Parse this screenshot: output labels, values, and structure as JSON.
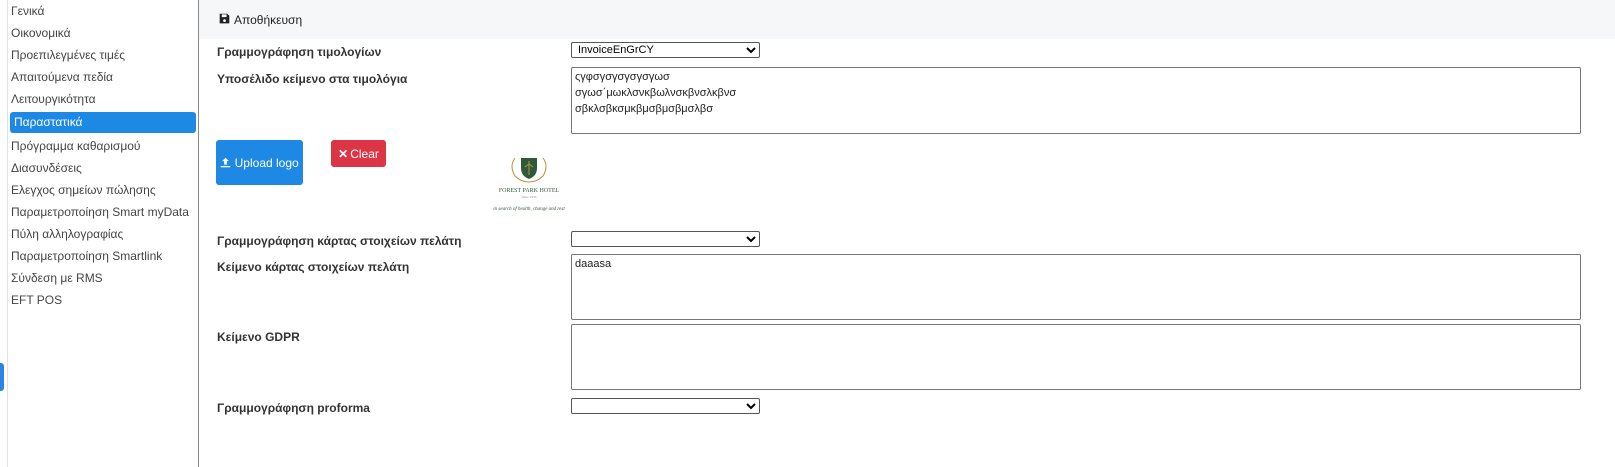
{
  "sidebar": {
    "items": [
      {
        "label": "Γενικά"
      },
      {
        "label": "Οικονομικά"
      },
      {
        "label": "Προεπιλεγμένες τιμές"
      },
      {
        "label": "Απαιτούμενα πεδία"
      },
      {
        "label": "Λειτουργικότητα"
      },
      {
        "label": "Παραστατικά",
        "active": true
      },
      {
        "label": "Πρόγραμμα καθαρισμού"
      },
      {
        "label": "Διασυνδέσεις"
      },
      {
        "label": "Ελεγχος σημείων πώλησης"
      },
      {
        "label": "Παραμετροποίηση Smart myData"
      },
      {
        "label": "Πύλη αλληλογραφίας"
      },
      {
        "label": "Παραμετροποίηση Smartlink"
      },
      {
        "label": "Σύνδεση με RMS"
      },
      {
        "label": "EFT POS"
      }
    ]
  },
  "toolbar": {
    "save_label": "Αποθήκευση",
    "save_icon": "floppy-disk-icon"
  },
  "form": {
    "invoice_layout_label": "Γραμμογράφηση τιμολογίων",
    "invoice_layout_value": "InvoiceEnGrCY",
    "invoice_footer_label": "Υποσέλιδο κείμενο στα τιμολόγια",
    "invoice_footer_value": "ςγφσγσγσγσγσγωσ\nσγωσ΄μωκλσνκβωλνσκβνσλκβνσ\nσβκλσβκσμκβμσβμσβμσλβσ",
    "upload_logo_label": "Upload logo",
    "upload_icon": "upload-icon",
    "clear_label": "Clear",
    "clear_icon": "x-icon",
    "logo": {
      "name": "FOREST PARK HOTEL",
      "since": "since 1935",
      "tagline": "in search of health, change and rest"
    },
    "customer_card_layout_label": "Γραμμογράφηση κάρτας στοιχείων πελάτη",
    "customer_card_layout_value": "",
    "customer_card_text_label": "Κείμενο κάρτας στοιχείων πελάτη",
    "customer_card_text_value": "daaasa",
    "gdpr_text_label": "Κείμενο GDPR",
    "gdpr_text_value": "",
    "proforma_layout_label": "Γραμμογράφηση proforma",
    "proforma_layout_value": ""
  },
  "colors": {
    "accent": "#1e88e5",
    "danger": "#dc3545",
    "logo_green": "#2f5a3a",
    "logo_gold": "#b8933f"
  }
}
